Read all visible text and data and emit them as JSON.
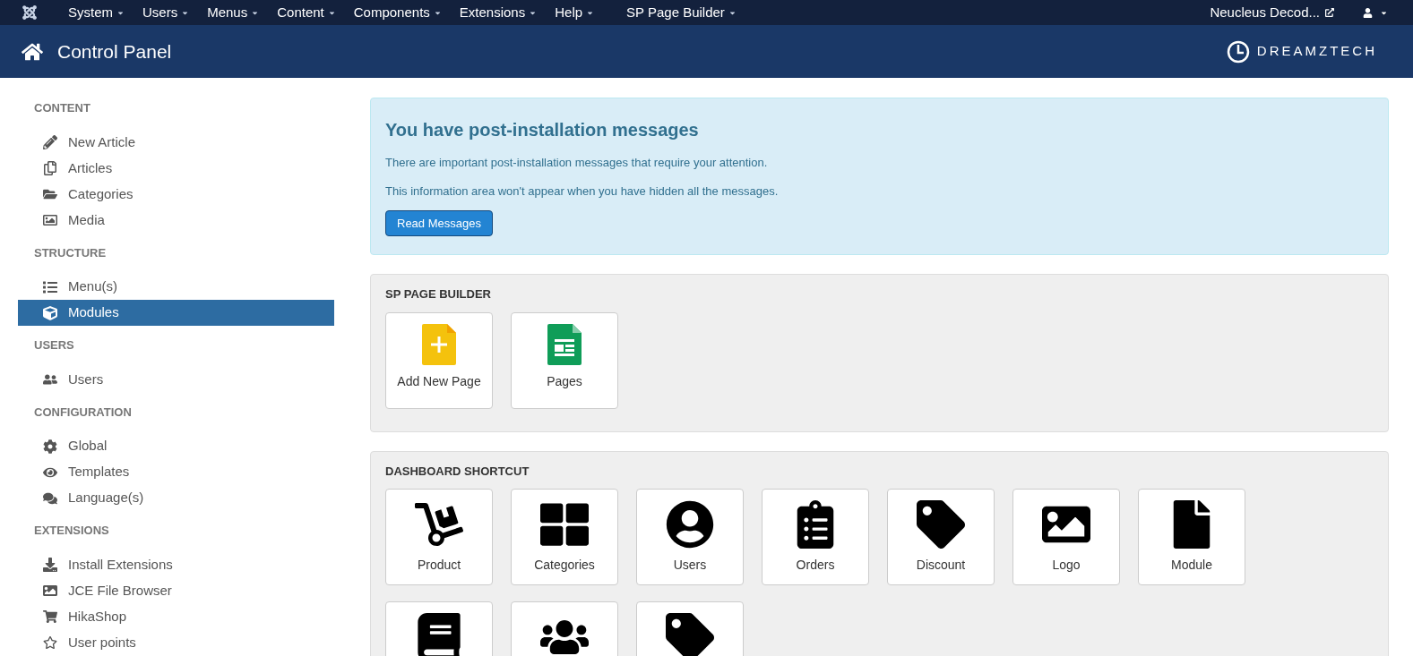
{
  "top_menu": [
    {
      "label": "System"
    },
    {
      "label": "Users"
    },
    {
      "label": "Menus"
    },
    {
      "label": "Content"
    },
    {
      "label": "Components"
    },
    {
      "label": "Extensions"
    },
    {
      "label": "Help"
    },
    {
      "label": "SP Page Builder"
    }
  ],
  "site_link": "Neucleus Decod...",
  "header": {
    "title": "Control Panel",
    "brand": "DREAMZTECH"
  },
  "sidebar": [
    {
      "heading": "CONTENT",
      "items": [
        {
          "label": "New Article",
          "selected": false
        },
        {
          "label": "Articles",
          "selected": false
        },
        {
          "label": "Categories",
          "selected": false
        },
        {
          "label": "Media",
          "selected": false
        }
      ]
    },
    {
      "heading": "STRUCTURE",
      "items": [
        {
          "label": "Menu(s)",
          "selected": false
        },
        {
          "label": "Modules",
          "selected": true
        }
      ]
    },
    {
      "heading": "USERS",
      "items": [
        {
          "label": "Users",
          "selected": false
        }
      ]
    },
    {
      "heading": "CONFIGURATION",
      "items": [
        {
          "label": "Global",
          "selected": false
        },
        {
          "label": "Templates",
          "selected": false
        },
        {
          "label": "Language(s)",
          "selected": false
        }
      ]
    },
    {
      "heading": "EXTENSIONS",
      "items": [
        {
          "label": "Install Extensions",
          "selected": false
        },
        {
          "label": "JCE File Browser",
          "selected": false
        },
        {
          "label": "HikaShop",
          "selected": false
        },
        {
          "label": "User points",
          "selected": false
        }
      ]
    }
  ],
  "alert": {
    "title": "You have post-installation messages",
    "lines": [
      "There are important post-installation messages that require your attention.",
      "This information area won't appear when you have hidden all the messages."
    ],
    "button": "Read Messages"
  },
  "sp_page_builder": {
    "heading": "SP PAGE BUILDER",
    "tiles": [
      {
        "label": "Add New Page"
      },
      {
        "label": "Pages"
      }
    ]
  },
  "dashboard_shortcut": {
    "heading": "DASHBOARD SHORTCUT",
    "tiles": [
      {
        "kind": "labeled",
        "label": "Product"
      },
      {
        "kind": "labeled",
        "label": "Categories"
      },
      {
        "kind": "labeled",
        "label": "Users"
      },
      {
        "kind": "labeled",
        "label": "Orders"
      },
      {
        "kind": "labeled",
        "label": "Discount"
      },
      {
        "kind": "labeled",
        "label": "Logo"
      },
      {
        "kind": "labeled",
        "label": "Module"
      },
      {
        "kind": "cut_off"
      },
      {
        "kind": "cut_off"
      },
      {
        "kind": "cut_off"
      }
    ]
  }
}
